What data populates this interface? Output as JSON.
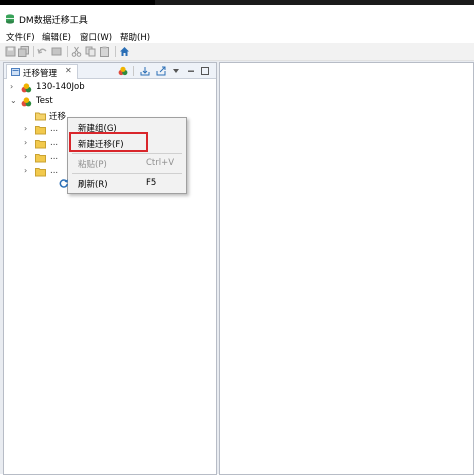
{
  "window": {
    "title": "DM数据迁移工具"
  },
  "menubar": {
    "items": [
      {
        "label": "文件(F)"
      },
      {
        "label": "编辑(E)"
      },
      {
        "label": "窗口(W)"
      },
      {
        "label": "帮助(H)"
      }
    ]
  },
  "toolbar": {
    "icons": [
      "save-icon",
      "save-all-icon",
      "undo-icon",
      "redo-icon",
      "cut-icon",
      "copy-icon",
      "paste-icon",
      "home-icon"
    ]
  },
  "left_view": {
    "tab_label": "迁移管理",
    "tab_close": "✕",
    "tree": [
      {
        "label": "130-140Job",
        "expanded": false
      },
      {
        "label": "Test",
        "expanded": true,
        "children": [
          {
            "label": "迁移"
          },
          {
            "label": "..."
          },
          {
            "label": "..."
          },
          {
            "label": "..."
          },
          {
            "label": "..."
          }
        ]
      }
    ]
  },
  "context_menu": {
    "items": [
      {
        "label": "新建组(G)",
        "shortcut": "",
        "enabled": true
      },
      {
        "label": "新建迁移(F)",
        "shortcut": "",
        "enabled": true,
        "highlighted": true
      },
      {
        "label": "粘贴(P)",
        "shortcut": "Ctrl+V",
        "enabled": false
      },
      {
        "label": "刷新(R)",
        "shortcut": "F5",
        "enabled": true
      }
    ]
  },
  "colors": {
    "highlight_border": "#d9262b",
    "view_border": "#b7bcc6",
    "workbench_bg": "#e9ecf1",
    "folder": "#f2c94c",
    "home_icon": "#2b6fb6"
  }
}
